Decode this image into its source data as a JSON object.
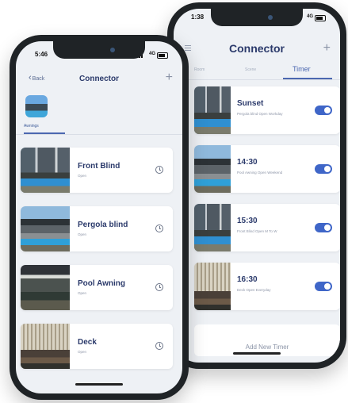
{
  "colors": {
    "accent": "#4b67b0",
    "toggle_on": "#3f66c8",
    "title": "#2b3a6b",
    "bezel": "#1f2326",
    "screen_bg": "#eef1f5"
  },
  "back_phone": {
    "status": {
      "time": "1:38",
      "network": "4G"
    },
    "header": {
      "title": "Connector",
      "menu_icon": "menu-icon",
      "add_icon": "plus-icon",
      "add_label": "+"
    },
    "tabs": [
      {
        "label": "Room",
        "active": false
      },
      {
        "label": "Scene",
        "active": false
      },
      {
        "label": "Timer",
        "active": true
      }
    ],
    "timers": [
      {
        "title": "Sunset",
        "subtitle": "Pergola blind Open Workday",
        "enabled": true
      },
      {
        "title": "14:30",
        "subtitle": "Pool Awning Open Weekend",
        "enabled": true
      },
      {
        "title": "15:30",
        "subtitle": "Front Blind Open M To W",
        "enabled": true
      },
      {
        "title": "16:30",
        "subtitle": "Deck Open Everyday",
        "enabled": true
      }
    ],
    "add_timer_label": "Add New Timer"
  },
  "front_phone": {
    "status": {
      "time": "5:46",
      "network": "4G"
    },
    "header": {
      "back_label": "Back",
      "title": "Connector",
      "add_icon": "plus-icon",
      "add_label": "+"
    },
    "category": {
      "label": "Awnings",
      "icon": "awning-thumbnail"
    },
    "devices": [
      {
        "name": "Front Blind",
        "status": "Open"
      },
      {
        "name": "Pergola blind",
        "status": "Open"
      },
      {
        "name": "Pool Awning",
        "status": "Open"
      },
      {
        "name": "Deck",
        "status": "Open"
      }
    ]
  }
}
